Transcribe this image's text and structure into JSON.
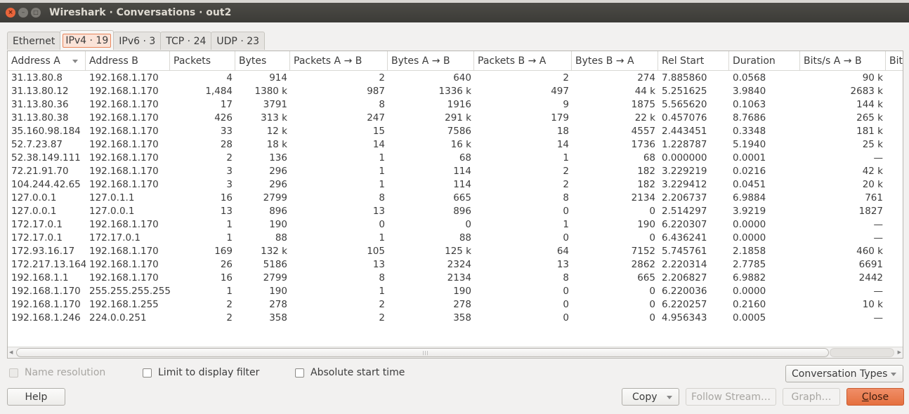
{
  "window": {
    "title": "Wireshark · Conversations · out2",
    "controls": {
      "close": "×",
      "minimize": "–",
      "maximize": "□"
    }
  },
  "tabs": [
    {
      "label": "Ethernet",
      "active": false
    },
    {
      "label": "IPv4 · 19",
      "active": true
    },
    {
      "label": "IPv6 · 3",
      "active": false
    },
    {
      "label": "TCP · 24",
      "active": false
    },
    {
      "label": "UDP · 23",
      "active": false
    }
  ],
  "table": {
    "columns": [
      "Address A",
      "Address B",
      "Packets",
      "Bytes",
      "Packets A → B",
      "Bytes A → B",
      "Packets B → A",
      "Bytes B → A",
      "Rel Start",
      "Duration",
      "Bits/s A → B",
      "Bits/s B → A"
    ],
    "sorted_column": "Address A",
    "rows": [
      [
        "31.13.80.8",
        "192.168.1.170",
        "4",
        "914",
        "2",
        "640",
        "2",
        "274",
        "7.885860",
        "0.0568",
        "90 k"
      ],
      [
        "31.13.80.12",
        "192.168.1.170",
        "1,484",
        "1380 k",
        "987",
        "1336 k",
        "497",
        "44 k",
        "5.251625",
        "3.9840",
        "2683 k"
      ],
      [
        "31.13.80.36",
        "192.168.1.170",
        "17",
        "3791",
        "8",
        "1916",
        "9",
        "1875",
        "5.565620",
        "0.1063",
        "144 k"
      ],
      [
        "31.13.80.38",
        "192.168.1.170",
        "426",
        "313 k",
        "247",
        "291 k",
        "179",
        "22 k",
        "0.457076",
        "8.7686",
        "265 k"
      ],
      [
        "35.160.98.184",
        "192.168.1.170",
        "33",
        "12 k",
        "15",
        "7586",
        "18",
        "4557",
        "2.443451",
        "0.3348",
        "181 k"
      ],
      [
        "52.7.23.87",
        "192.168.1.170",
        "28",
        "18 k",
        "14",
        "16 k",
        "14",
        "1736",
        "1.228787",
        "5.1940",
        "25 k"
      ],
      [
        "52.38.149.111",
        "192.168.1.170",
        "2",
        "136",
        "1",
        "68",
        "1",
        "68",
        "0.000000",
        "0.0001",
        "—"
      ],
      [
        "72.21.91.70",
        "192.168.1.170",
        "3",
        "296",
        "1",
        "114",
        "2",
        "182",
        "3.229219",
        "0.0216",
        "42 k"
      ],
      [
        "104.244.42.65",
        "192.168.1.170",
        "3",
        "296",
        "1",
        "114",
        "2",
        "182",
        "3.229412",
        "0.0451",
        "20 k"
      ],
      [
        "127.0.0.1",
        "127.0.1.1",
        "16",
        "2799",
        "8",
        "665",
        "8",
        "2134",
        "2.206737",
        "6.9884",
        "761"
      ],
      [
        "127.0.0.1",
        "127.0.0.1",
        "13",
        "896",
        "13",
        "896",
        "0",
        "0",
        "2.514297",
        "3.9219",
        "1827"
      ],
      [
        "172.17.0.1",
        "192.168.1.170",
        "1",
        "190",
        "0",
        "0",
        "1",
        "190",
        "6.220307",
        "0.0000",
        "—"
      ],
      [
        "172.17.0.1",
        "172.17.0.1",
        "1",
        "88",
        "1",
        "88",
        "0",
        "0",
        "6.436241",
        "0.0000",
        "—"
      ],
      [
        "172.93.16.17",
        "192.168.1.170",
        "169",
        "132 k",
        "105",
        "125 k",
        "64",
        "7152",
        "5.745761",
        "2.1858",
        "460 k"
      ],
      [
        "172.217.13.164",
        "192.168.1.170",
        "26",
        "5186",
        "13",
        "2324",
        "13",
        "2862",
        "2.220314",
        "2.7785",
        "6691"
      ],
      [
        "192.168.1.1",
        "192.168.1.170",
        "16",
        "2799",
        "8",
        "2134",
        "8",
        "665",
        "2.206827",
        "6.9882",
        "2442"
      ],
      [
        "192.168.1.170",
        "255.255.255.255",
        "1",
        "190",
        "1",
        "190",
        "0",
        "0",
        "6.220036",
        "0.0000",
        "—"
      ],
      [
        "192.168.1.170",
        "192.168.1.255",
        "2",
        "278",
        "2",
        "278",
        "0",
        "0",
        "6.220257",
        "0.2160",
        "10 k"
      ],
      [
        "192.168.1.246",
        "224.0.0.251",
        "2",
        "358",
        "2",
        "358",
        "0",
        "0",
        "4.956343",
        "0.0005",
        "—"
      ]
    ]
  },
  "options": {
    "name_resolution": {
      "label": "Name resolution",
      "checked": false,
      "enabled": false
    },
    "limit_filter": {
      "label": "Limit to display filter",
      "checked": false,
      "enabled": true
    },
    "absolute_time": {
      "label": "Absolute start time",
      "checked": false,
      "enabled": true
    },
    "conversation_types": "Conversation Types"
  },
  "buttons": {
    "help": "Help",
    "copy": "Copy",
    "follow_stream": "Follow Stream…",
    "graph": "Graph…",
    "close_prefix": "C",
    "close_rest": "lose"
  }
}
